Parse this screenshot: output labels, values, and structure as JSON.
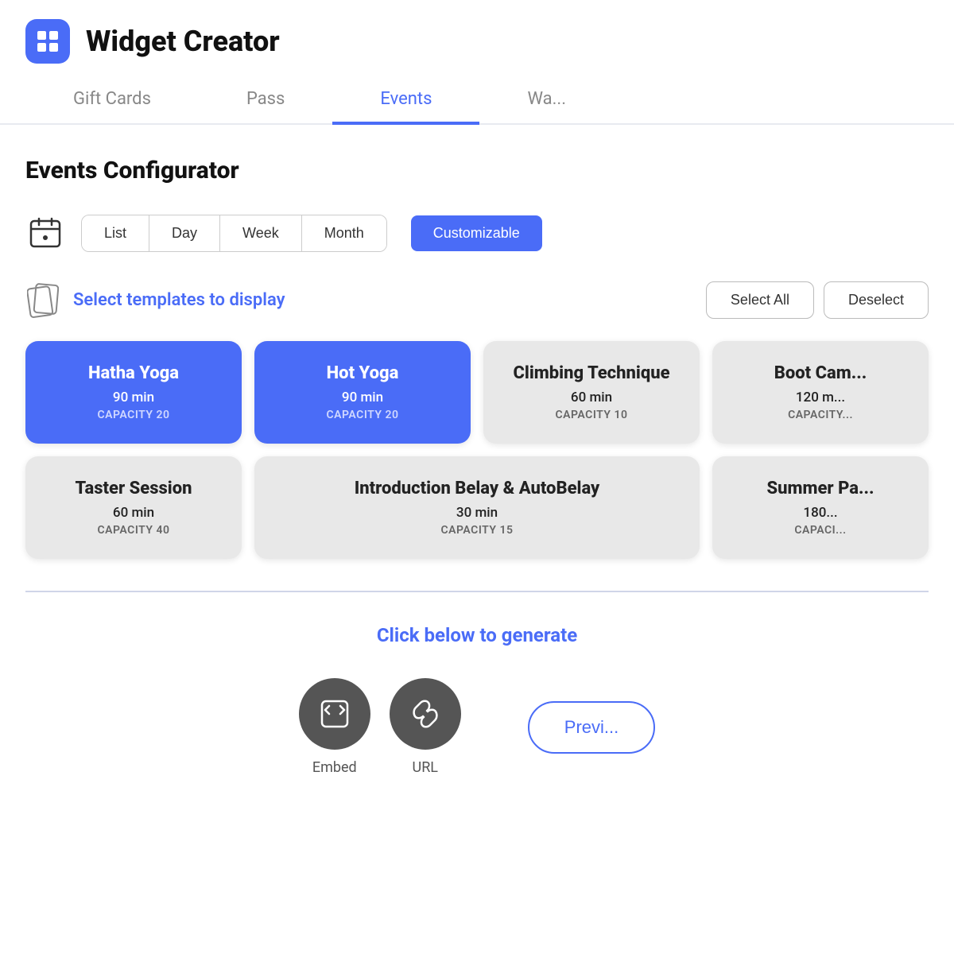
{
  "header": {
    "title": "Widget Creator",
    "logo_alt": "widget-logo"
  },
  "tabs": [
    {
      "label": "Gift Cards",
      "active": false
    },
    {
      "label": "Pass",
      "active": false
    },
    {
      "label": "Events",
      "active": true
    },
    {
      "label": "Wa...",
      "active": false
    }
  ],
  "section": {
    "title": "Events Configurator"
  },
  "view_options": {
    "buttons": [
      {
        "label": "List",
        "active": false
      },
      {
        "label": "Day",
        "active": false
      },
      {
        "label": "Week",
        "active": false
      },
      {
        "label": "Month",
        "active": false
      }
    ],
    "active_button": {
      "label": "Customizable"
    }
  },
  "templates": {
    "heading": "Select templates to display",
    "select_all": "Select All",
    "deselect_all": "Deselect",
    "cards": [
      {
        "name": "Hatha Yoga",
        "duration": "90 min",
        "capacity": "CAPACITY 20",
        "selected": true
      },
      {
        "name": "Hot Yoga",
        "duration": "90 min",
        "capacity": "CAPACITY 20",
        "selected": true
      },
      {
        "name": "Climbing Technique",
        "duration": "60 min",
        "capacity": "CAPACITY 10",
        "selected": false
      },
      {
        "name": "Boot Cam...",
        "duration": "120 m...",
        "capacity": "CAPACITY...",
        "selected": false
      },
      {
        "name": "Taster Session",
        "duration": "60 min",
        "capacity": "CAPACITY 40",
        "selected": false
      },
      {
        "name": "Introduction Belay & AutoBelay",
        "duration": "30 min",
        "capacity": "CAPACITY 15",
        "selected": false
      },
      {
        "name": "Summer Pa...",
        "duration": "180...",
        "capacity": "CAPACI...",
        "selected": false
      }
    ]
  },
  "generate": {
    "title": "Click below to generate",
    "embed_label": "Embed",
    "url_label": "URL",
    "preview_label": "Previ..."
  }
}
